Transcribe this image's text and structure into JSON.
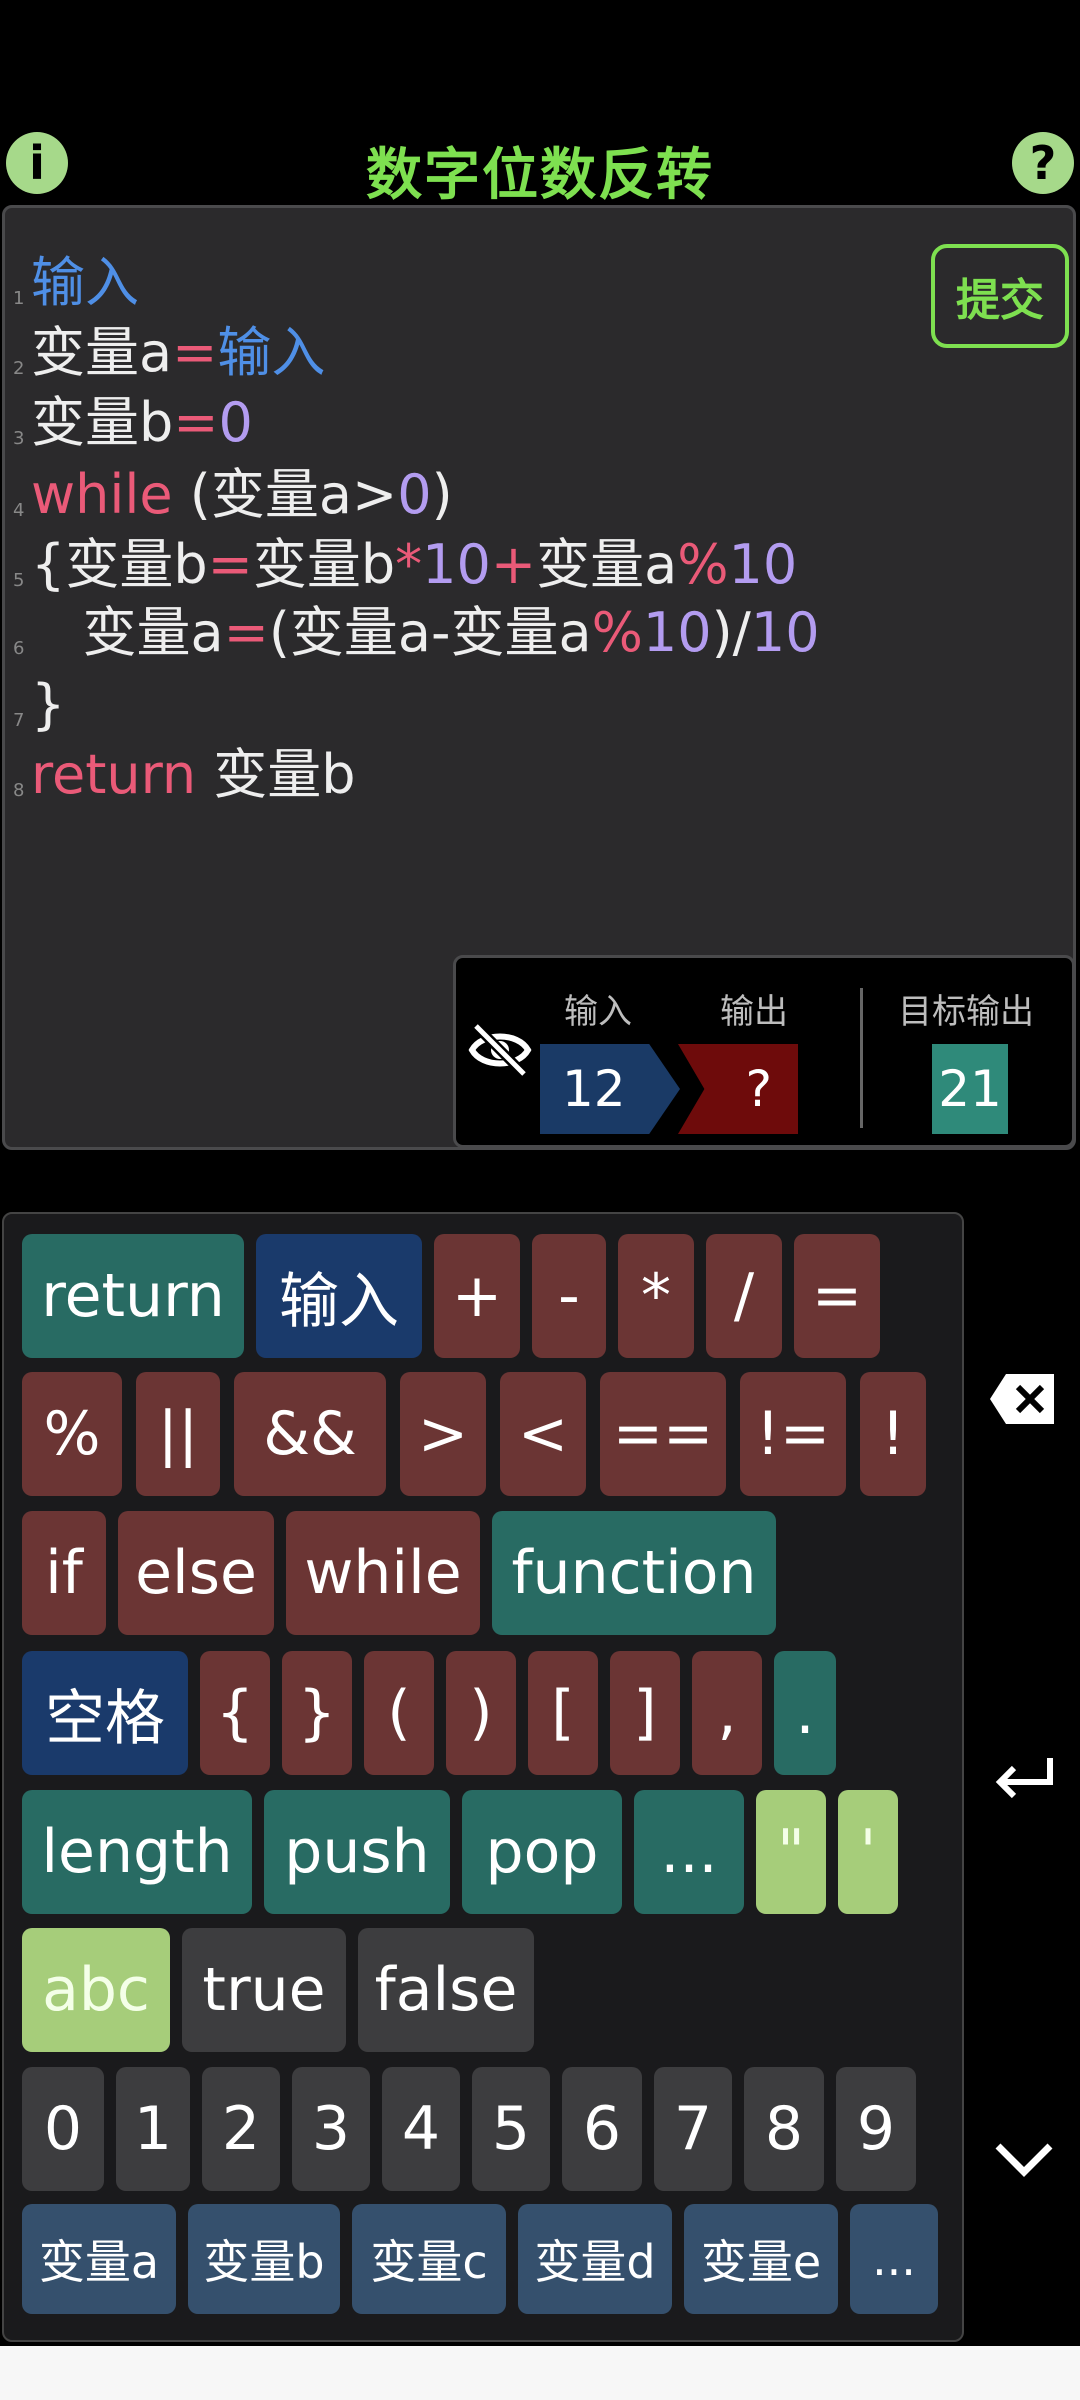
{
  "header": {
    "title": "数字位数反转",
    "info_icon_glyph": "i",
    "help_icon_glyph": "?"
  },
  "editor": {
    "submit_label": "提交",
    "lines": [
      {
        "n": "1",
        "parts": [
          {
            "t": "输入",
            "c": "kw-blue"
          }
        ]
      },
      {
        "n": "2",
        "parts": [
          {
            "t": "变量a"
          },
          {
            "t": "=",
            "c": "op"
          },
          {
            "t": "输入",
            "c": "kw-blue"
          }
        ]
      },
      {
        "n": "3",
        "parts": [
          {
            "t": "变量b"
          },
          {
            "t": "=",
            "c": "op"
          },
          {
            "t": "0",
            "c": "num"
          }
        ]
      },
      {
        "n": "4",
        "parts": [
          {
            "t": "while",
            "c": "kw-red"
          },
          {
            "t": " (变量a>"
          },
          {
            "t": "0",
            "c": "num"
          },
          {
            "t": ")"
          }
        ]
      },
      {
        "n": "5",
        "parts": [
          {
            "t": "{变量b"
          },
          {
            "t": "=",
            "c": "op"
          },
          {
            "t": "变量b"
          },
          {
            "t": "*",
            "c": "op"
          },
          {
            "t": "10",
            "c": "num"
          },
          {
            "t": "+",
            "c": "op"
          },
          {
            "t": "变量a"
          },
          {
            "t": "%",
            "c": "op"
          },
          {
            "t": "10",
            "c": "num"
          }
        ]
      },
      {
        "n": "6",
        "parts": [
          {
            "t": "   变量a"
          },
          {
            "t": "=",
            "c": "op"
          },
          {
            "t": "(变量a-变量a"
          },
          {
            "t": "%",
            "c": "op"
          },
          {
            "t": "10",
            "c": "num"
          },
          {
            "t": ")/"
          },
          {
            "t": "10",
            "c": "num"
          }
        ]
      },
      {
        "n": "7",
        "parts": [
          {
            "t": "}"
          }
        ]
      },
      {
        "n": "8",
        "parts": [
          {
            "t": "return",
            "c": "kw-red"
          },
          {
            "t": " 变量b"
          }
        ]
      }
    ]
  },
  "io": {
    "input_label": "输入",
    "output_label": "输出",
    "target_label": "目标输出",
    "input_value": "12",
    "output_value": "?",
    "target_value": "21",
    "visibility_icon": "eye-off-icon"
  },
  "keyboard": {
    "rows": [
      [
        {
          "label": "return",
          "style": "k-teal"
        },
        {
          "label": "输入",
          "style": "k-blue"
        },
        {
          "label": "+",
          "style": "k-maroon"
        },
        {
          "label": "-",
          "style": "k-maroon"
        },
        {
          "label": "*",
          "style": "k-maroon"
        },
        {
          "label": "/",
          "style": "k-maroon"
        },
        {
          "label": "=",
          "style": "k-maroon"
        }
      ],
      [
        {
          "label": "%",
          "style": "k-maroon"
        },
        {
          "label": "||",
          "style": "k-maroon"
        },
        {
          "label": "&&",
          "style": "k-maroon"
        },
        {
          "label": ">",
          "style": "k-maroon"
        },
        {
          "label": "<",
          "style": "k-maroon"
        },
        {
          "label": "==",
          "style": "k-maroon"
        },
        {
          "label": "!=",
          "style": "k-maroon"
        },
        {
          "label": "!",
          "style": "k-maroon"
        }
      ],
      [
        {
          "label": "if",
          "style": "k-maroon"
        },
        {
          "label": "else",
          "style": "k-maroon"
        },
        {
          "label": "while",
          "style": "k-maroon"
        },
        {
          "label": "function",
          "style": "k-teal"
        }
      ],
      [
        {
          "label": "空格",
          "style": "k-blue"
        },
        {
          "label": "{",
          "style": "k-maroon"
        },
        {
          "label": "}",
          "style": "k-maroon"
        },
        {
          "label": "(",
          "style": "k-maroon"
        },
        {
          "label": ")",
          "style": "k-maroon"
        },
        {
          "label": "[",
          "style": "k-maroon"
        },
        {
          "label": "]",
          "style": "k-maroon"
        },
        {
          "label": ",",
          "style": "k-maroon"
        },
        {
          "label": ".",
          "style": "k-teal"
        }
      ],
      [
        {
          "label": "length",
          "style": "k-teal"
        },
        {
          "label": "push",
          "style": "k-teal"
        },
        {
          "label": "pop",
          "style": "k-teal"
        },
        {
          "label": "...",
          "style": "k-teal"
        },
        {
          "label": "\"",
          "style": "k-green"
        },
        {
          "label": "'",
          "style": "k-green"
        }
      ],
      [
        {
          "label": "abc",
          "style": "k-green"
        },
        {
          "label": "true",
          "style": "k-gray"
        },
        {
          "label": "false",
          "style": "k-gray"
        }
      ],
      [
        {
          "label": "0",
          "style": "k-gray"
        },
        {
          "label": "1",
          "style": "k-gray"
        },
        {
          "label": "2",
          "style": "k-gray"
        },
        {
          "label": "3",
          "style": "k-gray"
        },
        {
          "label": "4",
          "style": "k-gray"
        },
        {
          "label": "5",
          "style": "k-gray"
        },
        {
          "label": "6",
          "style": "k-gray"
        },
        {
          "label": "7",
          "style": "k-gray"
        },
        {
          "label": "8",
          "style": "k-gray"
        },
        {
          "label": "9",
          "style": "k-gray"
        }
      ],
      [
        {
          "label": "变量a",
          "style": "k-slate"
        },
        {
          "label": "变量b",
          "style": "k-slate"
        },
        {
          "label": "变量c",
          "style": "k-slate"
        },
        {
          "label": "变量d",
          "style": "k-slate"
        },
        {
          "label": "变量e",
          "style": "k-slate"
        },
        {
          "label": "...",
          "style": "k-slate"
        }
      ]
    ],
    "side_icons": [
      "backspace-icon",
      "enter-icon",
      "chevron-down-icon"
    ]
  }
}
